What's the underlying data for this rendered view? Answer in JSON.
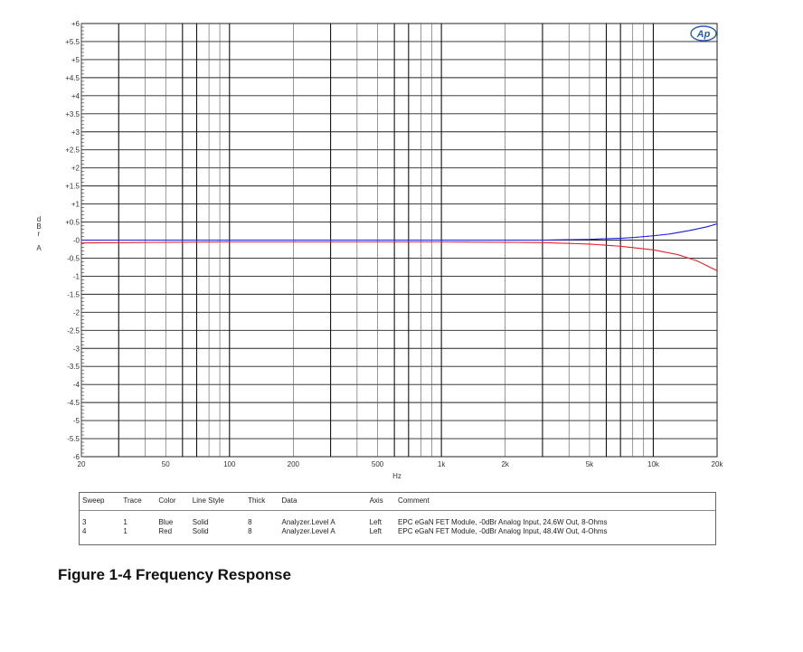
{
  "chart_data": {
    "type": "line",
    "title": "",
    "xlabel": "Hz",
    "ylabel": "d B r  A",
    "x_scale": "log",
    "xlim": [
      20,
      20000
    ],
    "ylim": [
      -6,
      6
    ],
    "grid": true,
    "x_tick_labels": [
      {
        "value": 20,
        "label": "20"
      },
      {
        "value": 50,
        "label": "50"
      },
      {
        "value": 100,
        "label": "100"
      },
      {
        "value": 200,
        "label": "200"
      },
      {
        "value": 500,
        "label": "500"
      },
      {
        "value": 1000,
        "label": "1k"
      },
      {
        "value": 2000,
        "label": "2k"
      },
      {
        "value": 5000,
        "label": "5k"
      },
      {
        "value": 10000,
        "label": "10k"
      },
      {
        "value": 20000,
        "label": "20k"
      }
    ],
    "y_tick_labels": [
      {
        "value": 6,
        "label": "+6"
      },
      {
        "value": 5.5,
        "label": "+5.5"
      },
      {
        "value": 5,
        "label": "+5"
      },
      {
        "value": 4.5,
        "label": "+4.5"
      },
      {
        "value": 4,
        "label": "+4"
      },
      {
        "value": 3.5,
        "label": "+3.5"
      },
      {
        "value": 3,
        "label": "+3"
      },
      {
        "value": 2.5,
        "label": "+2.5"
      },
      {
        "value": 2,
        "label": "+2"
      },
      {
        "value": 1.5,
        "label": "+1.5"
      },
      {
        "value": 1,
        "label": "+1"
      },
      {
        "value": 0.5,
        "label": "+0.5"
      },
      {
        "value": 0,
        "label": "-0"
      },
      {
        "value": -0.5,
        "label": "-0.5"
      },
      {
        "value": -1,
        "label": "-1"
      },
      {
        "value": -1.5,
        "label": "-1.5"
      },
      {
        "value": -2,
        "label": "-2"
      },
      {
        "value": -2.5,
        "label": "-2.5"
      },
      {
        "value": -3,
        "label": "-3"
      },
      {
        "value": -3.5,
        "label": "-3.5"
      },
      {
        "value": -4,
        "label": "-4"
      },
      {
        "value": -4.5,
        "label": "-4.5"
      },
      {
        "value": -5,
        "label": "-5"
      },
      {
        "value": -5.5,
        "label": "-5.5"
      },
      {
        "value": -6,
        "label": "-6"
      }
    ],
    "series": [
      {
        "color": "#1c1cd8",
        "points": [
          [
            20,
            0.0
          ],
          [
            100,
            0.0
          ],
          [
            1000,
            0.0
          ],
          [
            3000,
            0.0
          ],
          [
            5000,
            0.02
          ],
          [
            6000,
            0.04
          ],
          [
            7000,
            0.05
          ],
          [
            8000,
            0.07
          ],
          [
            10000,
            0.12
          ],
          [
            12000,
            0.17
          ],
          [
            15000,
            0.27
          ],
          [
            18000,
            0.37
          ],
          [
            20000,
            0.45
          ]
        ]
      },
      {
        "color": "#e8202a",
        "points": [
          [
            20,
            -0.08
          ],
          [
            50,
            -0.06
          ],
          [
            100,
            -0.05
          ],
          [
            1000,
            -0.05
          ],
          [
            2000,
            -0.06
          ],
          [
            3000,
            -0.07
          ],
          [
            5000,
            -0.11
          ],
          [
            7000,
            -0.17
          ],
          [
            10000,
            -0.27
          ],
          [
            13000,
            -0.4
          ],
          [
            16000,
            -0.57
          ],
          [
            20000,
            -0.85
          ]
        ]
      }
    ],
    "logo": "Ap"
  },
  "legend": {
    "headers": [
      "Sweep",
      "Trace",
      "Color",
      "Line Style",
      "Thick",
      "Data",
      "Axis",
      "Comment"
    ],
    "rows": [
      [
        "3",
        "1",
        "Blue",
        "Solid",
        "8",
        "Analyzer.Level A",
        "Left",
        "EPC eGaN FET Module, -0dBr Analog Input, 24.6W Out, 8-Ohms"
      ],
      [
        "4",
        "1",
        "Red",
        "Solid",
        "8",
        "Analyzer.Level A",
        "Left",
        "EPC eGaN FET Module, -0dBr Analog Input, 48.4W Out, 4-Ohms"
      ]
    ]
  },
  "caption": "Figure 1-4 Frequency Response"
}
